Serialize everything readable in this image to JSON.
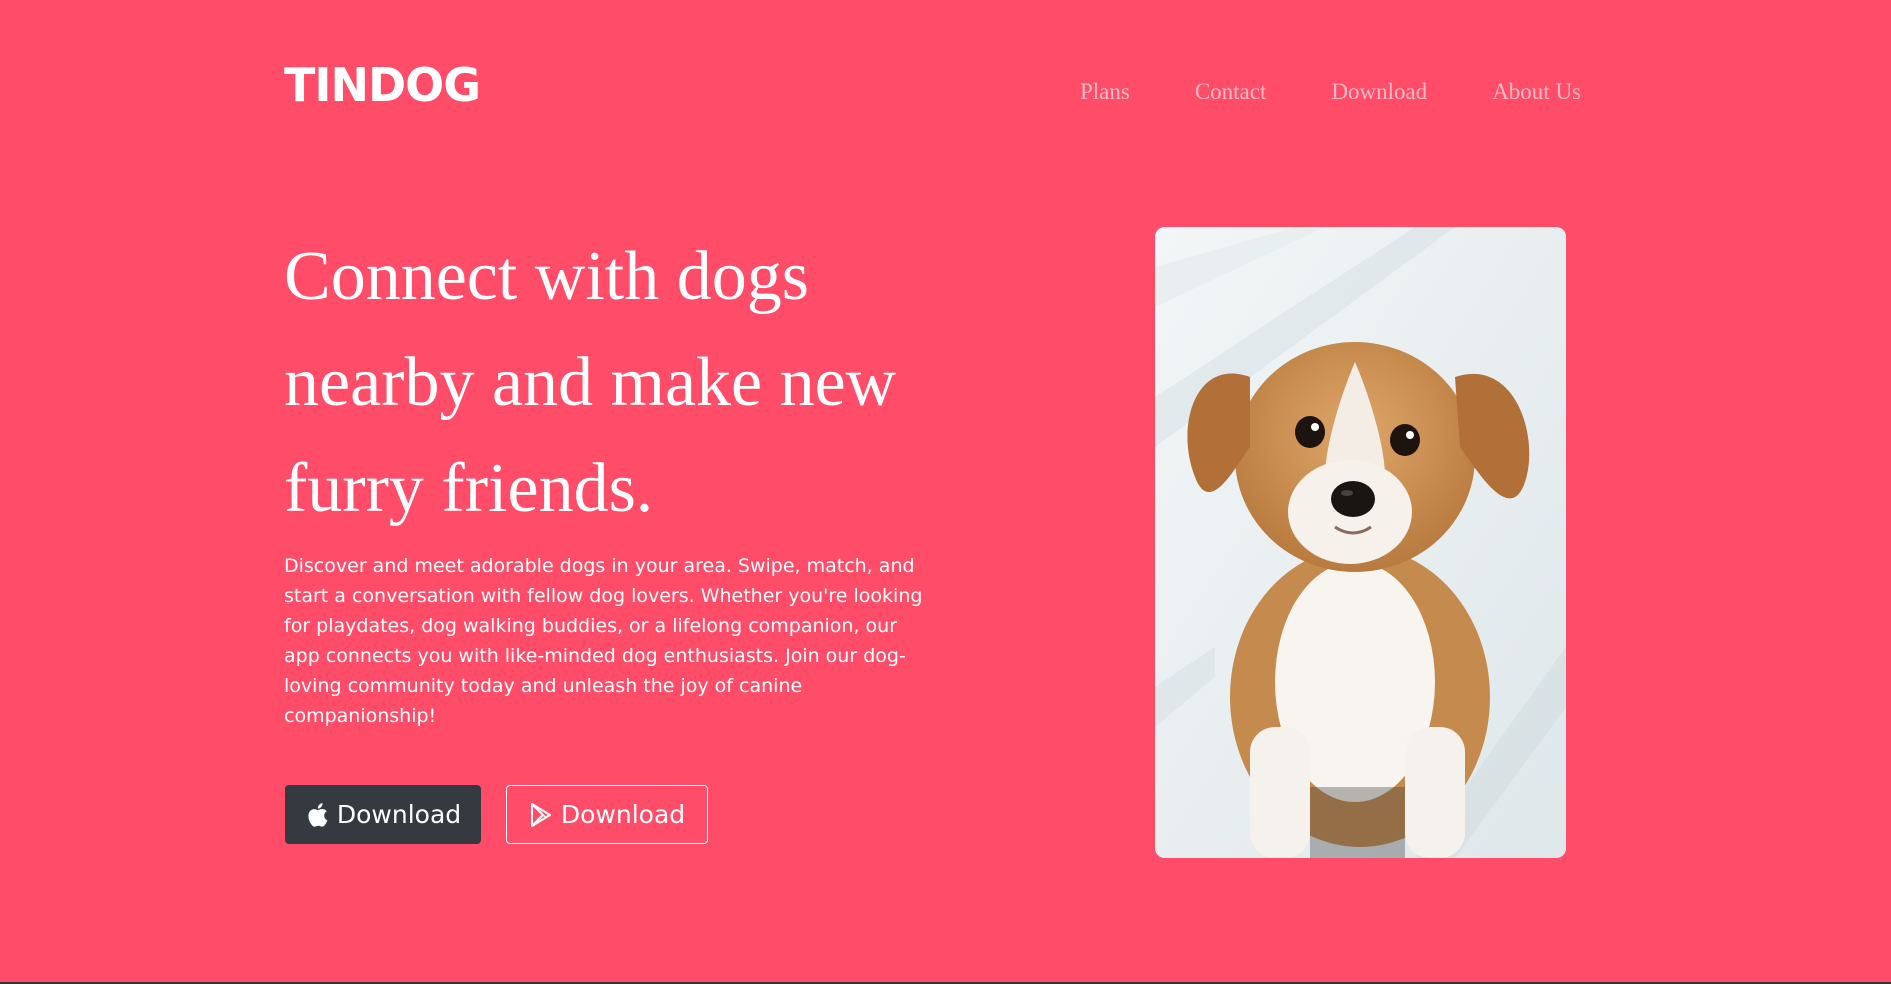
{
  "navbar": {
    "brand": "TINDOG",
    "links": [
      {
        "label": "Plans"
      },
      {
        "label": "Contact"
      },
      {
        "label": "Download"
      },
      {
        "label": "About Us"
      }
    ]
  },
  "hero": {
    "headline": "Connect with dogs nearby and make new furry friends.",
    "description": "Discover and meet adorable dogs in your area. Swipe, match, and start a conversation with fellow dog lovers. Whether you're looking for playdates, dog walking buddies, or a lifelong companion, our app connects you with like-minded dog enthusiasts. Join our dog-loving community today and unleash the joy of canine companionship!",
    "buttons": {
      "apple": {
        "label": "Download",
        "icon": "apple-icon"
      },
      "google": {
        "label": "Download",
        "icon": "google-play-icon"
      }
    },
    "image": {
      "subject": "puppy-image"
    }
  },
  "colors": {
    "background": "#ff4c68",
    "dark_button": "#343a40",
    "text": "#ffffff"
  }
}
